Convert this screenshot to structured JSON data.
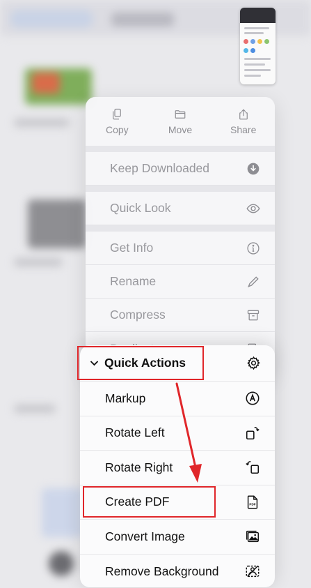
{
  "top_actions": [
    {
      "label": "Copy",
      "icon": "copy-icon"
    },
    {
      "label": "Move",
      "icon": "folder-icon"
    },
    {
      "label": "Share",
      "icon": "share-icon"
    }
  ],
  "menu_items": [
    {
      "label": "Keep Downloaded",
      "icon": "download-circle-icon"
    },
    {
      "label": "Quick Look",
      "icon": "eye-icon"
    },
    {
      "label": "Get Info",
      "icon": "info-icon"
    },
    {
      "label": "Rename",
      "icon": "pencil-icon"
    },
    {
      "label": "Compress",
      "icon": "archive-box-icon"
    },
    {
      "label": "Duplicate",
      "icon": "duplicate-icon"
    }
  ],
  "quick_actions": {
    "header": "Quick Actions",
    "header_icons": [
      "chevron-down-icon",
      "gear-icon"
    ],
    "items": [
      {
        "label": "Markup",
        "icon": "markup-icon"
      },
      {
        "label": "Rotate Left",
        "icon": "rotate-left-icon"
      },
      {
        "label": "Rotate Right",
        "icon": "rotate-right-icon"
      },
      {
        "label": "Create PDF",
        "icon": "pdf-document-icon"
      },
      {
        "label": "Convert Image",
        "icon": "convert-image-icon"
      },
      {
        "label": "Remove Background",
        "icon": "remove-background-icon"
      }
    ]
  },
  "colors": {
    "annotation": "#e0262a",
    "dimmed_text": "#98989d",
    "active_text": "#111111"
  }
}
